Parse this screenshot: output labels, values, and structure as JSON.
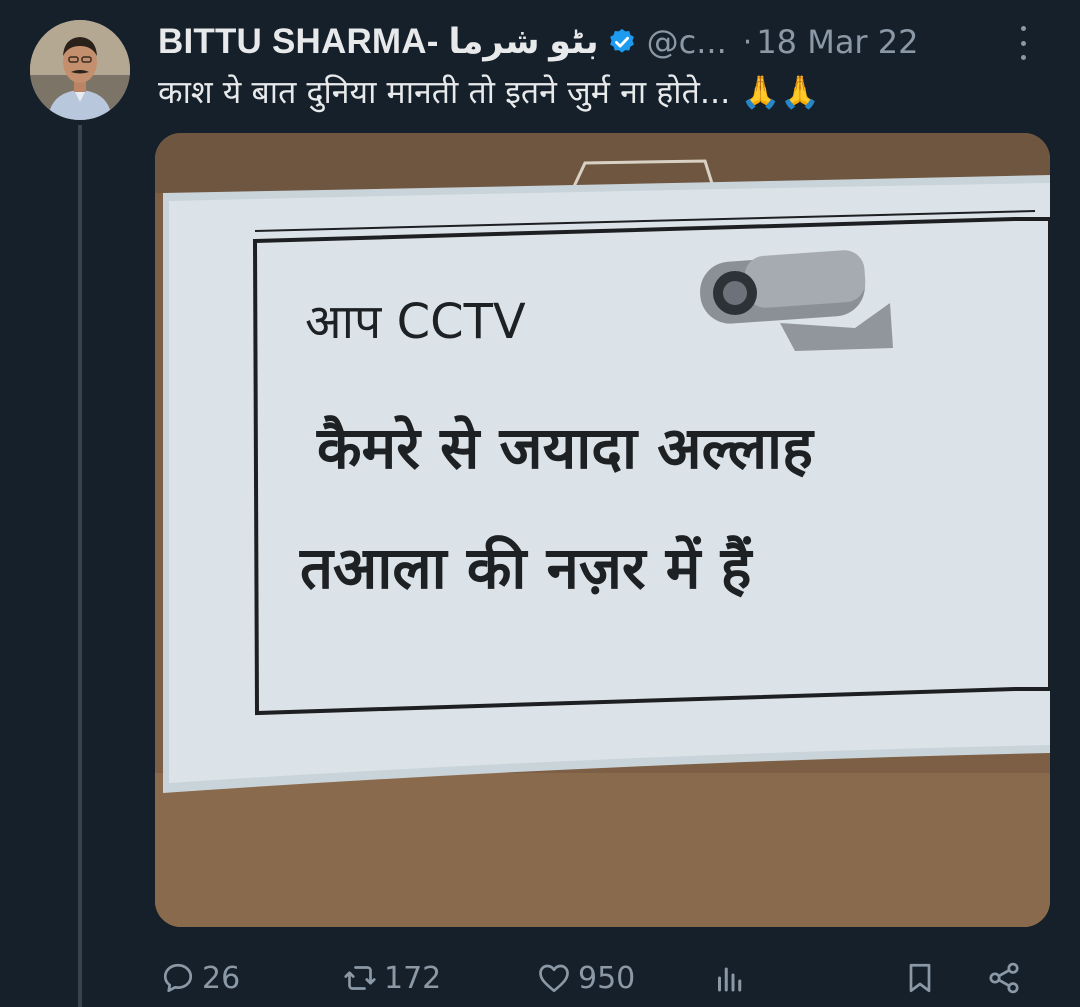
{
  "tweet": {
    "author_name": "BITTU SHARMA- بٹو شرما",
    "handle": "@c...",
    "separator": "·",
    "date": "18 Mar 22",
    "text": "काश ये बात दुनिया मानती तो इतने जुर्म ना होते... 🙏🙏",
    "verified": true
  },
  "media": {
    "sign_line1": "आप CCTV",
    "sign_line2": "कैमरे  से जयादा अल्लाह",
    "sign_line3": "तआला  की नज़र में हैं",
    "camera_icon": "cctv-camera-icon"
  },
  "actions": {
    "reply_count": "26",
    "retweet_count": "172",
    "like_count": "950"
  },
  "colors": {
    "background": "#15202b",
    "secondary_text": "#8b98a5",
    "verified_blue": "#1d9bf0",
    "thread_line": "#38444d"
  }
}
